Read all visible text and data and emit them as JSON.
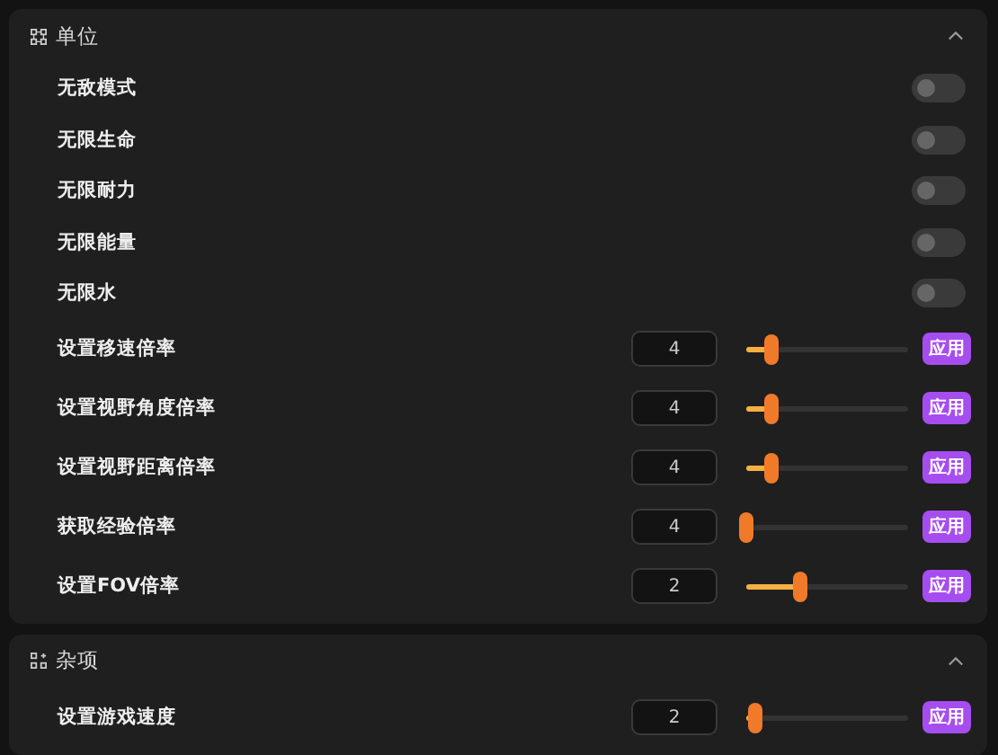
{
  "sections": [
    {
      "title": "单位",
      "expanded": true,
      "items": [
        {
          "kind": "toggle",
          "label": "无敌模式",
          "on": false
        },
        {
          "kind": "toggle",
          "label": "无限生命",
          "on": false
        },
        {
          "kind": "toggle",
          "label": "无限耐力",
          "on": false
        },
        {
          "kind": "toggle",
          "label": "无限能量",
          "on": false
        },
        {
          "kind": "toggle",
          "label": "无限水",
          "on": false
        },
        {
          "kind": "slider",
          "label": "设置移速倍率",
          "value": "4",
          "level": 0.15,
          "button": "应用"
        },
        {
          "kind": "slider",
          "label": "设置视野角度倍率",
          "value": "4",
          "level": 0.15,
          "button": "应用"
        },
        {
          "kind": "slider",
          "label": "设置视野距离倍率",
          "value": "4",
          "level": 0.15,
          "button": "应用"
        },
        {
          "kind": "slider",
          "label": "获取经验倍率",
          "value": "4",
          "level": 0,
          "button": "应用"
        },
        {
          "kind": "slider",
          "label": "设置FOV倍率",
          "value": "2",
          "level": 0.33,
          "button": "应用"
        }
      ]
    },
    {
      "title": "杂项",
      "expanded": true,
      "items": [
        {
          "kind": "slider",
          "label": "设置游戏速度",
          "value": "2",
          "level": 0.05,
          "button": "应用"
        }
      ]
    }
  ]
}
